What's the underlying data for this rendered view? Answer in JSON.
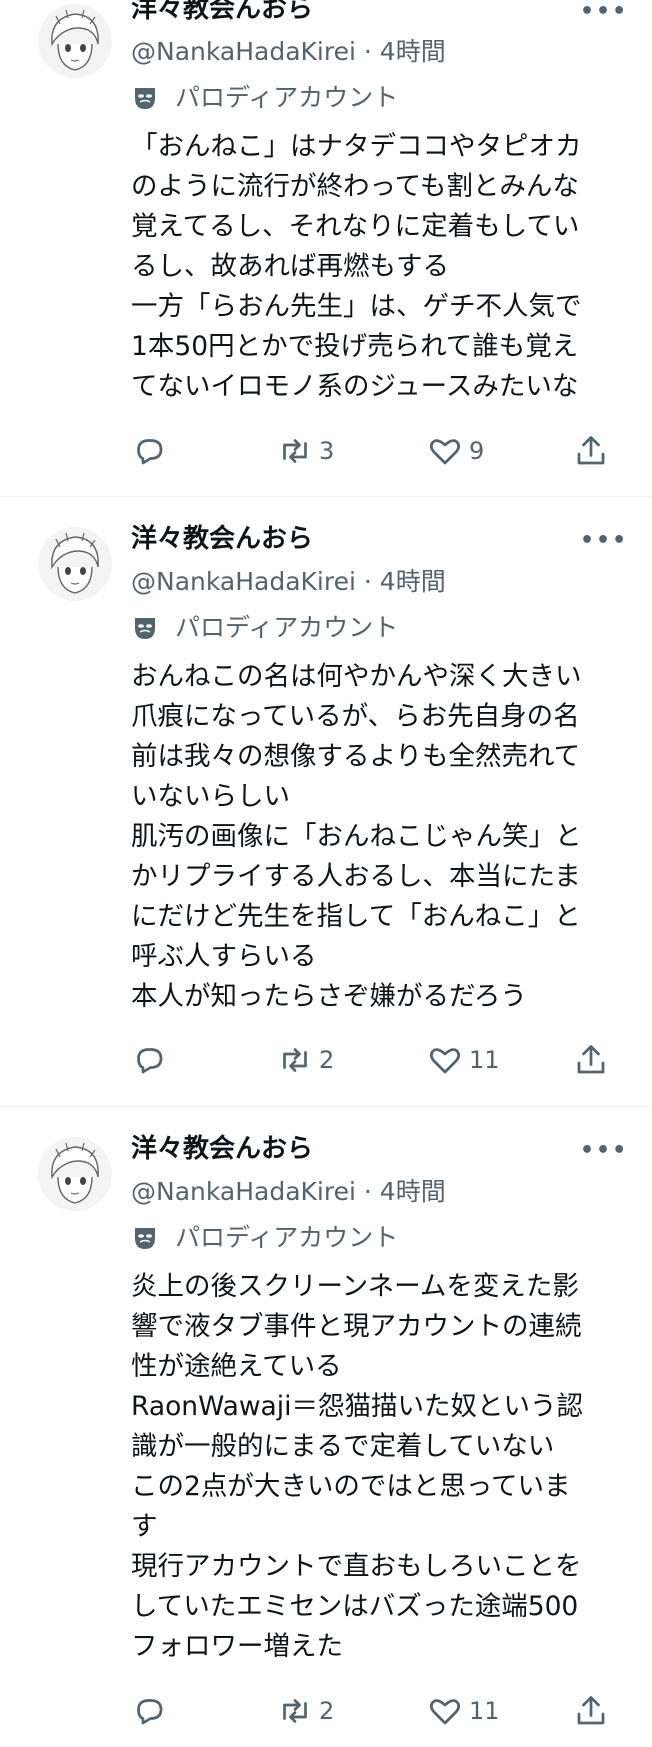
{
  "timeline": {
    "tweets": [
      {
        "display_name": "洋々教会んおら",
        "handle": "@NankaHadaKirei",
        "separator": "·",
        "time": "4時間",
        "label": "パロディアカウント",
        "lines": [
          "「おんねこ」はナタデココやタピオカ",
          "のように流行が終わっても割とみんな",
          "覚えてるし、それなりに定着もしてい",
          "るし、故あれば再燃もする",
          "一方「らおん先生」は、ゲチ不人気で",
          "1本50円とかで投げ売られて誰も覚え",
          "てないイロモノ系のジュースみたいな"
        ],
        "retweets": "3",
        "likes": "9"
      },
      {
        "display_name": "洋々教会んおら",
        "handle": "@NankaHadaKirei",
        "separator": "·",
        "time": "4時間",
        "label": "パロディアカウント",
        "lines": [
          "おんねこの名は何やかんや深く大きい",
          "爪痕になっているが、らお先自身の名",
          "前は我々の想像するよりも全然売れて",
          "いないらしい",
          "肌汚の画像に「おんねこじゃん笑」と",
          "かリプライする人おるし、本当にたま",
          "にだけど先生を指して「おんねこ」と",
          "呼ぶ人すらいる",
          "本人が知ったらさぞ嫌がるだろう"
        ],
        "retweets": "2",
        "likes": "11"
      },
      {
        "display_name": "洋々教会んおら",
        "handle": "@NankaHadaKirei",
        "separator": "·",
        "time": "4時間",
        "label": "パロディアカウント",
        "lines": [
          "炎上の後スクリーンネームを変えた影",
          "響で液タブ事件と現アカウントの連続",
          "性が途絶えている",
          "RaonWawaji＝怨猫描いた奴という認",
          "識が一般的にまるで定着していない",
          "この2点が大きいのではと思っていま",
          "す",
          "現行アカウントで直おもしろいことを",
          "していたエミセンはバズった途端500",
          "フォロワー増えた"
        ],
        "retweets": "2",
        "likes": "11"
      }
    ]
  },
  "icons": {
    "more": "more-horizontal-icon",
    "reply": "reply-icon",
    "retweet": "retweet-icon",
    "like": "heart-icon",
    "share": "share-icon",
    "parody": "theater-mask-icon"
  },
  "colors": {
    "text": "#0f1419",
    "secondary": "#536471",
    "divider": "#eff3f4"
  }
}
